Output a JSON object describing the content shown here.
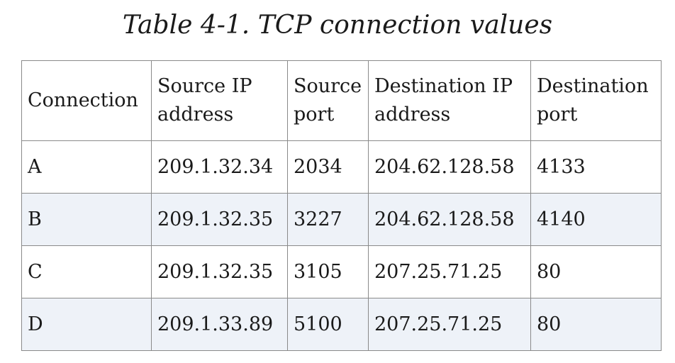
{
  "caption": "Table 4-1. TCP connection values",
  "table": {
    "headers": [
      [
        "Connection",
        ""
      ],
      [
        "Source IP",
        "address"
      ],
      [
        "Source",
        "port"
      ],
      [
        "Destination IP",
        "address"
      ],
      [
        "Destination",
        "port"
      ]
    ],
    "rows": [
      [
        "A",
        "209.1.32.34",
        "2034",
        "204.62.128.58",
        "4133"
      ],
      [
        "B",
        "209.1.32.35",
        "3227",
        "204.62.128.58",
        "4140"
      ],
      [
        "C",
        "209.1.32.35",
        "3105",
        "207.25.71.25",
        "80"
      ],
      [
        "D",
        "209.1.33.89",
        "5100",
        "207.25.71.25",
        "80"
      ]
    ],
    "shaded_row_color": "#eef2f8",
    "border_color": "#8a8a8a"
  }
}
